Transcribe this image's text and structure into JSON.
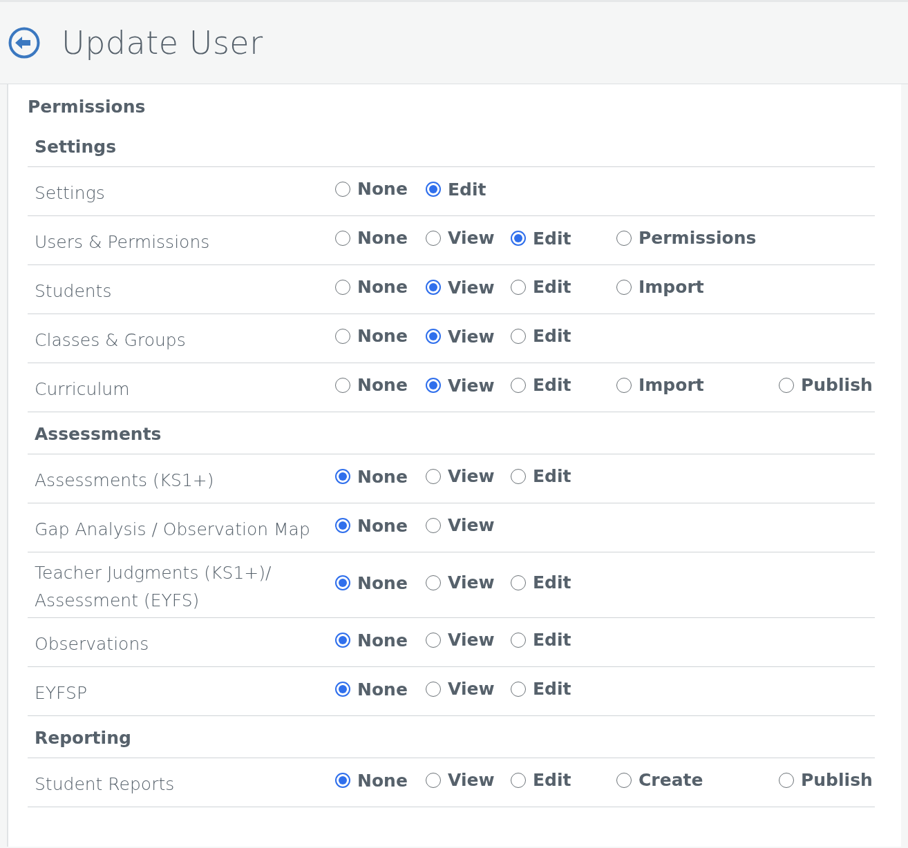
{
  "header": {
    "title": "Update User"
  },
  "panel": {
    "title": "Permissions",
    "sections": [
      {
        "title": "Settings",
        "rows": [
          {
            "label": "Settings",
            "options": [
              {
                "label": "None",
                "selected": false
              },
              {
                "label": "Edit",
                "selected": true
              }
            ]
          },
          {
            "label": "Users & Permissions",
            "options": [
              {
                "label": "None",
                "selected": false
              },
              {
                "label": "View",
                "selected": false
              },
              {
                "label": "Edit",
                "selected": true
              },
              {
                "label": "Permissions",
                "selected": false
              }
            ]
          },
          {
            "label": "Students",
            "options": [
              {
                "label": "None",
                "selected": false
              },
              {
                "label": "View",
                "selected": true
              },
              {
                "label": "Edit",
                "selected": false
              },
              {
                "label": "Import",
                "selected": false
              }
            ]
          },
          {
            "label": "Classes & Groups",
            "options": [
              {
                "label": "None",
                "selected": false
              },
              {
                "label": "View",
                "selected": true
              },
              {
                "label": "Edit",
                "selected": false
              }
            ]
          },
          {
            "label": "Curriculum",
            "options": [
              {
                "label": "None",
                "selected": false
              },
              {
                "label": "View",
                "selected": true
              },
              {
                "label": "Edit",
                "selected": false
              },
              {
                "label": "Import",
                "selected": false
              },
              {
                "label": "Publish",
                "selected": false
              }
            ]
          }
        ]
      },
      {
        "title": "Assessments",
        "rows": [
          {
            "label": "Assessments (KS1+)",
            "options": [
              {
                "label": "None",
                "selected": true
              },
              {
                "label": "View",
                "selected": false
              },
              {
                "label": "Edit",
                "selected": false
              }
            ]
          },
          {
            "label": "Gap Analysis / Observation Map",
            "options": [
              {
                "label": "None",
                "selected": true
              },
              {
                "label": "View",
                "selected": false
              }
            ]
          },
          {
            "label": "Teacher Judgments (KS1+)/ Assessment (EYFS)",
            "options": [
              {
                "label": "None",
                "selected": true
              },
              {
                "label": "View",
                "selected": false
              },
              {
                "label": "Edit",
                "selected": false
              }
            ]
          },
          {
            "label": "Observations",
            "options": [
              {
                "label": "None",
                "selected": true
              },
              {
                "label": "View",
                "selected": false
              },
              {
                "label": "Edit",
                "selected": false
              }
            ]
          },
          {
            "label": "EYFSP",
            "options": [
              {
                "label": "None",
                "selected": true
              },
              {
                "label": "View",
                "selected": false
              },
              {
                "label": "Edit",
                "selected": false
              }
            ]
          }
        ]
      },
      {
        "title": "Reporting",
        "rows": [
          {
            "label": "Student Reports",
            "options": [
              {
                "label": "None",
                "selected": true
              },
              {
                "label": "View",
                "selected": false
              },
              {
                "label": "Edit",
                "selected": false
              },
              {
                "label": "Create",
                "selected": false
              },
              {
                "label": "Publish",
                "selected": false
              }
            ]
          }
        ]
      }
    ]
  }
}
